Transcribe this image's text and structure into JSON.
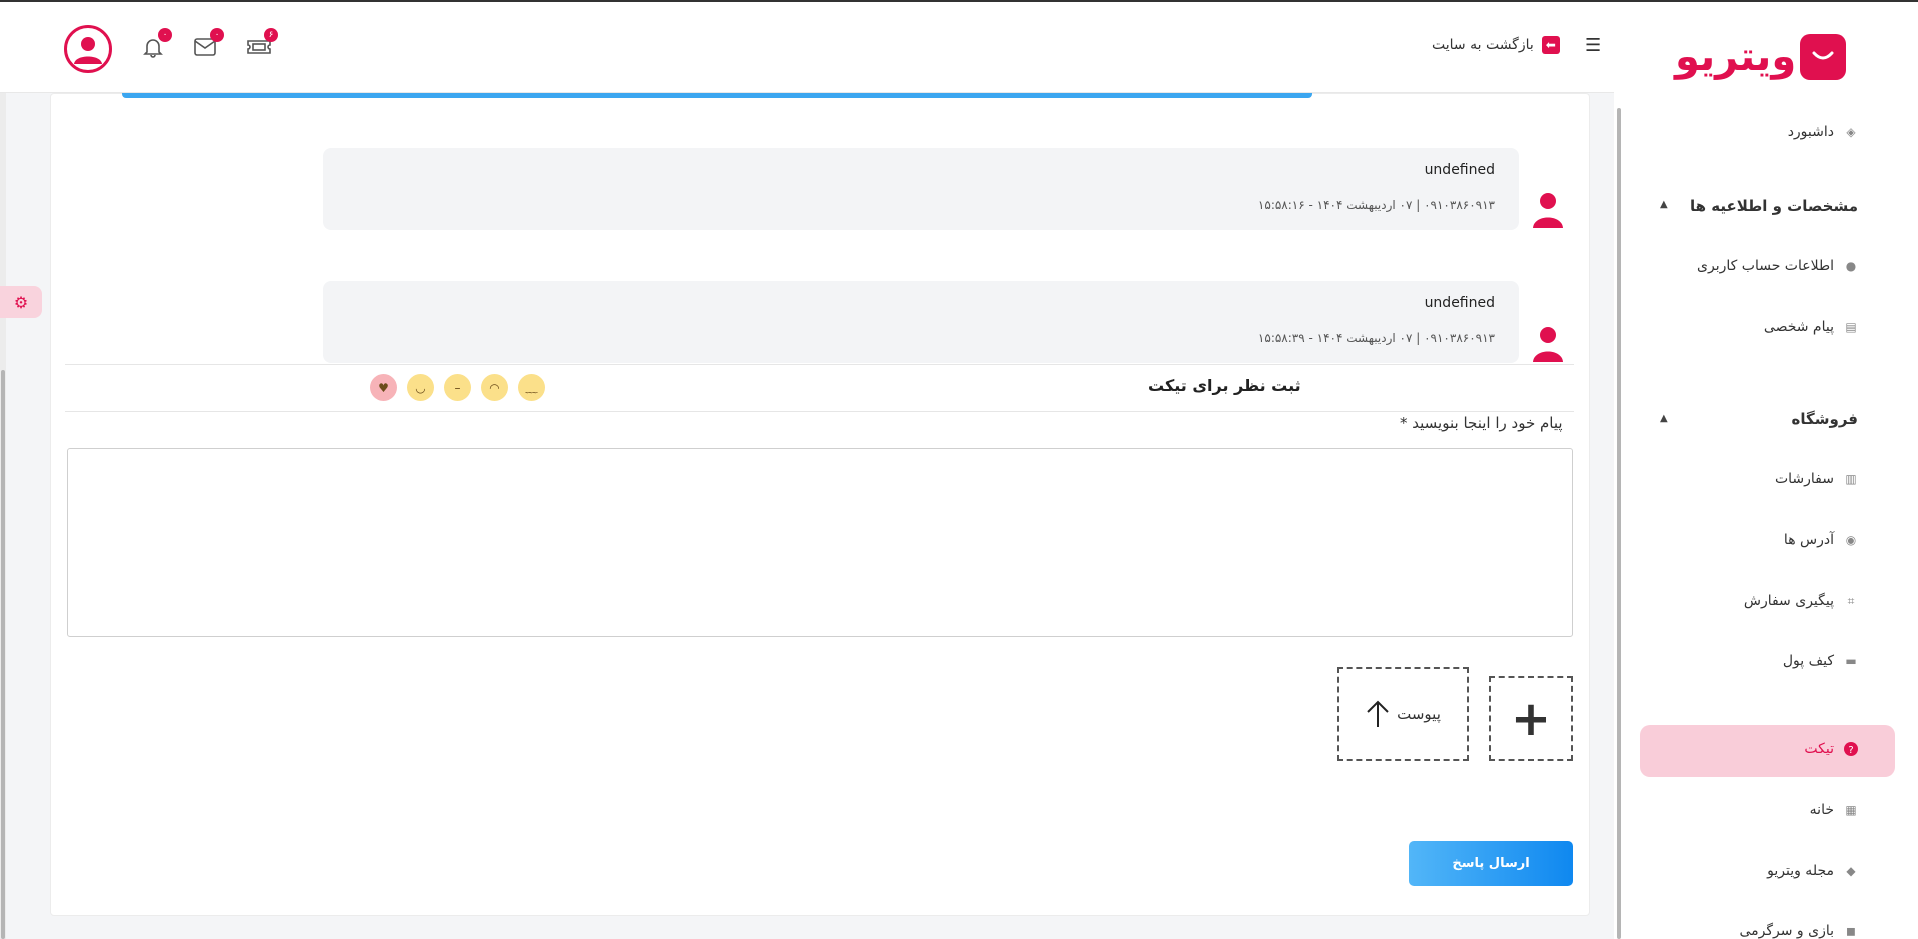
{
  "header": {
    "back_label": "بازگشت به سایت",
    "badges": {
      "tickets": "۶",
      "messages": "۰",
      "notifications": "۰"
    }
  },
  "sidebar": {
    "logo_text": "ویتریو",
    "dashboard": "داشبورد",
    "section_info": "مشخصات و اطلاعیه ها",
    "account_info": "اطلاعات حساب کاربری",
    "private_message": "پیام شخصی",
    "section_shop": "فروشگاه",
    "orders": "سفارشات",
    "addresses": "آدرس ها",
    "order_tracking": "پیگیری سفارش",
    "wallet": "کیف پول",
    "ticket": "تیکت",
    "home": "خانه",
    "magazine": "مجله ویتریو",
    "games": "بازی و سرگرمی"
  },
  "messages": [
    {
      "text": "undefined",
      "meta": "۰۹۱۰۳۸۶۰۹۱۳ | ۰۷ اردیبهشت ۱۴۰۴ - ۱۵:۵۸:۱۶"
    },
    {
      "text": "undefined",
      "meta": "۰۹۱۰۳۸۶۰۹۱۳ | ۰۷ اردیبهشت ۱۴۰۴ - ۱۵:۵۸:۳۹"
    }
  ],
  "rating": {
    "title": "ثبت نظر برای تیکت",
    "emojis": [
      "angry",
      "sad",
      "neutral",
      "smile",
      "love"
    ]
  },
  "form": {
    "message_label": "پیام خود را اینجا بنویسید *",
    "attach_label": "پیوست",
    "add_label": "+",
    "send_label": "ارسال پاسخ"
  },
  "colors": {
    "brand": "#e0104f",
    "accent": "#0f88f0"
  }
}
